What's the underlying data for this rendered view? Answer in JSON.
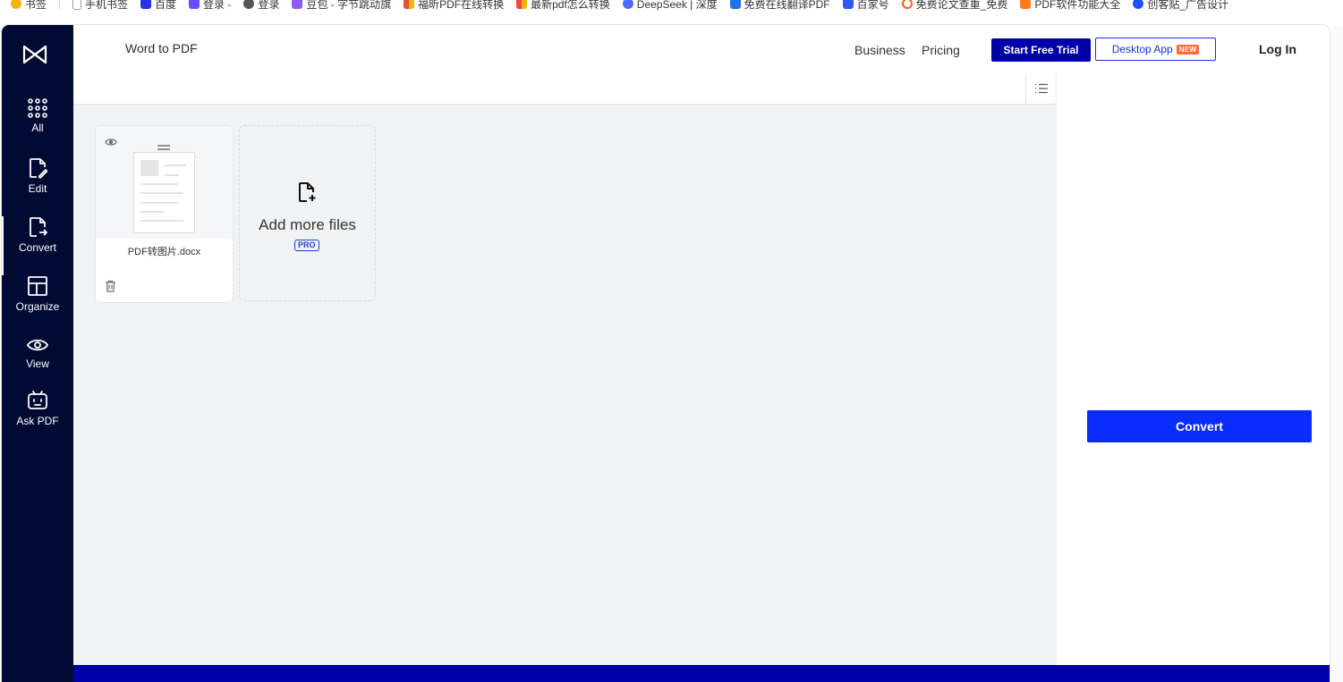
{
  "bookmarks": [
    {
      "label": "书签",
      "color": "#f5b400"
    },
    {
      "label": "手机书签",
      "color": "#9aa0a6"
    },
    {
      "label": "百度",
      "color": "#2932e1"
    },
    {
      "label": "登录 -",
      "color": "#6b4cff"
    },
    {
      "label": "登录",
      "color": "#333333"
    },
    {
      "label": "豆包 - 字节跳动旗",
      "color": "#8a5cf5"
    },
    {
      "label": "福昕PDF在线转换",
      "color": "#e94b3c"
    },
    {
      "label": "最新pdf怎么转换",
      "color": "#e94b3c"
    },
    {
      "label": "DeepSeek | 深度",
      "color": "#4d6bfe"
    },
    {
      "label": "免费在线翻译PDF",
      "color": "#1a73e8"
    },
    {
      "label": "百家号",
      "color": "#2b5bff"
    },
    {
      "label": "免费论文查重_免费",
      "color": "#ff5a1f"
    },
    {
      "label": "PDF软件功能大全",
      "color": "#ff7a1a"
    },
    {
      "label": "创客贴_广告设计",
      "color": "#1e4fff"
    }
  ],
  "sidebar": {
    "items": [
      {
        "label": "All",
        "icon": "grid-icon"
      },
      {
        "label": "Edit",
        "icon": "edit-file-icon"
      },
      {
        "label": "Convert",
        "icon": "convert-file-icon"
      },
      {
        "label": "Organize",
        "icon": "layout-icon"
      },
      {
        "label": "View",
        "icon": "eye-icon"
      },
      {
        "label": "Ask PDF",
        "icon": "bot-icon"
      }
    ]
  },
  "header": {
    "tool_title": "Word to PDF",
    "business": "Business",
    "pricing": "Pricing",
    "start_trial": "Start Free Trial",
    "desktop_app": "Desktop App",
    "new_badge": "NEW",
    "login": "Log In"
  },
  "files": [
    {
      "name": "PDF转图片.docx"
    }
  ],
  "add_more": {
    "label": "Add more files",
    "badge": "PRO"
  },
  "panel": {
    "convert": "Convert"
  },
  "colors": {
    "sidebar_bg": "#000a32",
    "primary": "#0a2cff",
    "brand_dark": "#0000a8",
    "workspace_bg": "#f1f2f4"
  }
}
